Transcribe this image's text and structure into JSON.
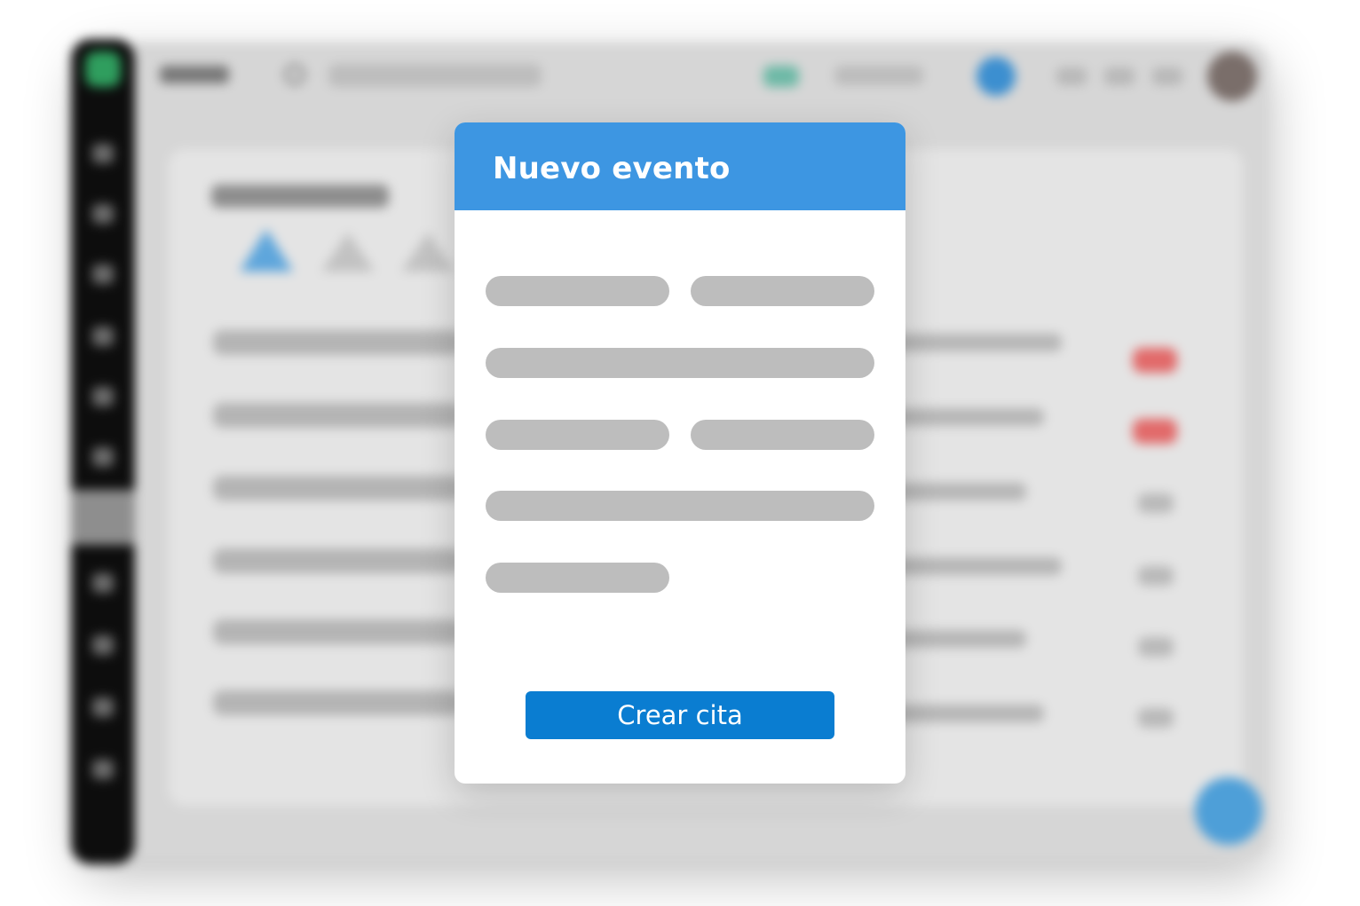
{
  "modal": {
    "title": "Nuevo evento",
    "submit_label": "Crear cita"
  },
  "colors": {
    "modal_header": "#3d96e2",
    "primary_button": "#0a7dd1",
    "placeholder_field": "#bdbdbd",
    "background_alert": "#e26a6a",
    "background_accent": "#4e9fd8"
  },
  "icons": {
    "background_fab": "add-icon",
    "background_search": "search-icon"
  }
}
